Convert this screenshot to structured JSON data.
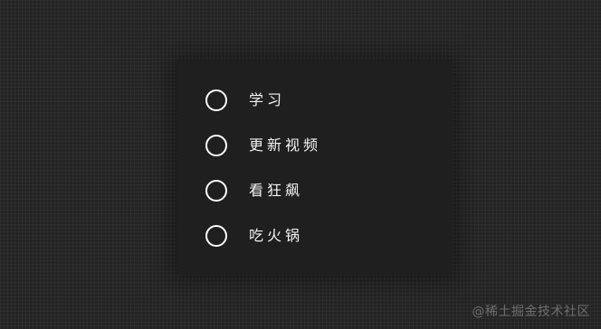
{
  "todo_list": {
    "items": [
      {
        "label": "学习",
        "checked": false
      },
      {
        "label": "更新视频",
        "checked": false
      },
      {
        "label": "看狂飙",
        "checked": false
      },
      {
        "label": "吃火锅",
        "checked": false
      }
    ]
  },
  "watermark": {
    "text": "@稀土掘金技术社区"
  }
}
